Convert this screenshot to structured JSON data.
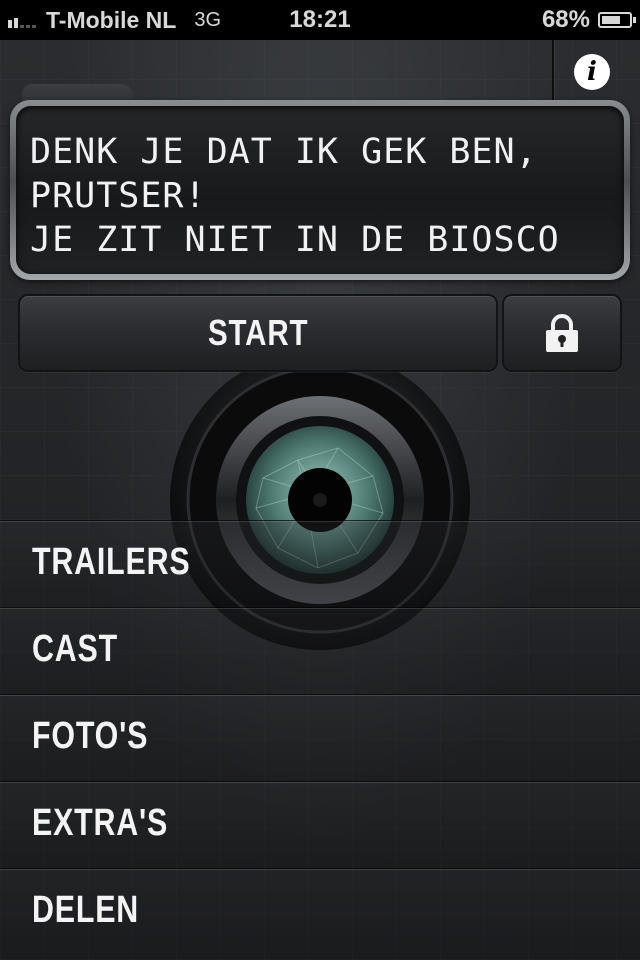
{
  "status_bar": {
    "carrier": "T-Mobile NL",
    "network": "3G",
    "time": "18:21",
    "battery": "68%",
    "battery_level": 0.68,
    "signal_bars": 2
  },
  "message_panel": {
    "text": "DENK JE DAT IK GEK BEN,\nPRUTSER!\nJE ZIT NIET IN DE BIOSCO"
  },
  "buttons": {
    "start_label": "START",
    "info_icon": "info-icon",
    "lock_icon": "lock-icon"
  },
  "menu": {
    "items": [
      {
        "label": "TRAILERS"
      },
      {
        "label": "CAST"
      },
      {
        "label": "FOTO'S"
      },
      {
        "label": "EXTRA'S"
      },
      {
        "label": "DELEN"
      }
    ]
  },
  "colors": {
    "lens_iris": "#5f8f86",
    "background": "#1b1c1e"
  }
}
